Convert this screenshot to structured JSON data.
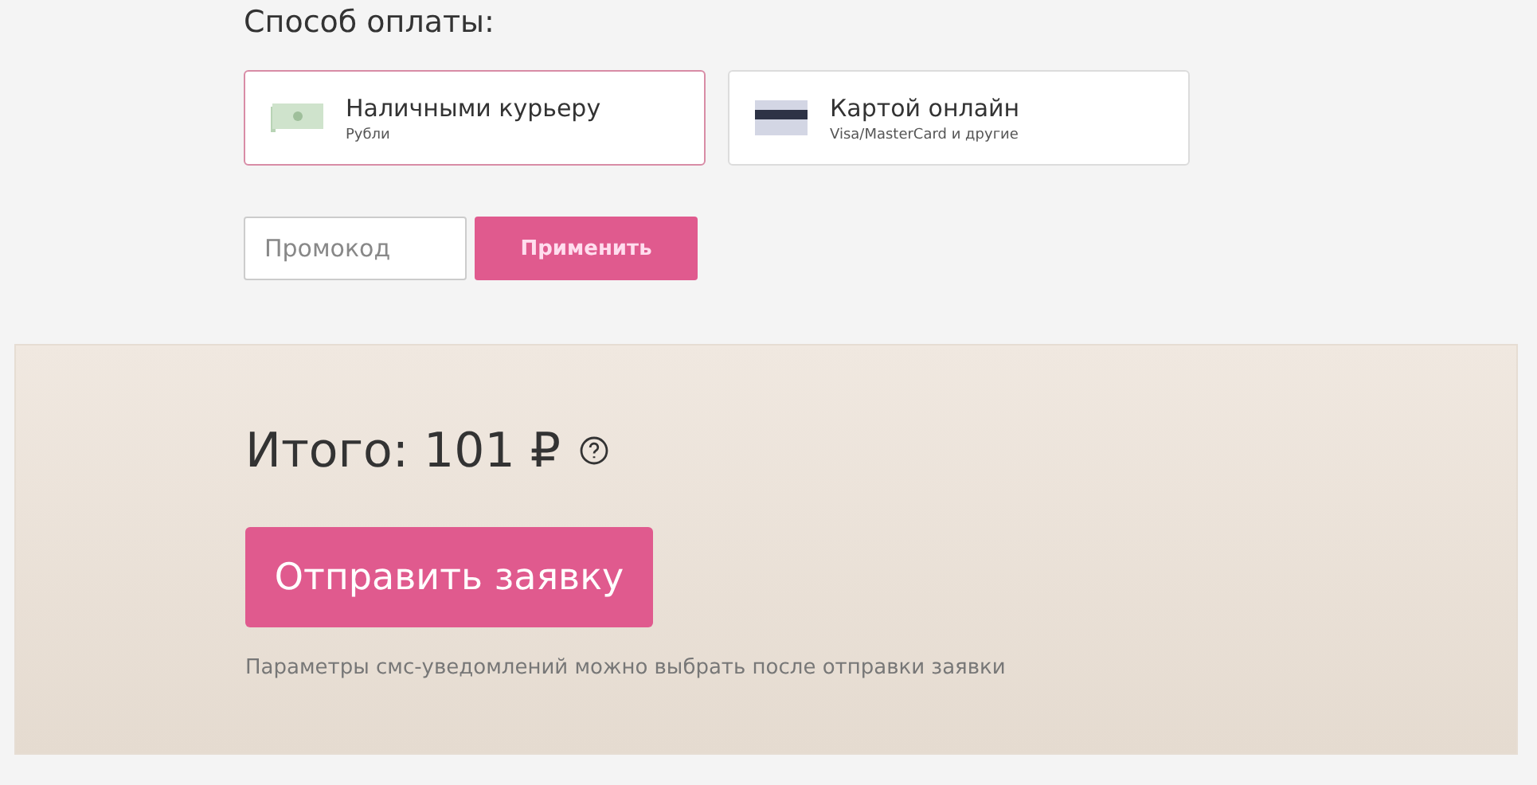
{
  "payment": {
    "title": "Способ оплаты:",
    "options": [
      {
        "kind": "cash",
        "label": "Наличными курьеру",
        "sublabel": "Рубли",
        "selected": true
      },
      {
        "kind": "card",
        "label": "Картой онлайн",
        "sublabel": "Visa/MasterCard и другие",
        "selected": false
      }
    ]
  },
  "promo": {
    "placeholder": "Промокод",
    "button": "Применить"
  },
  "summary": {
    "total": "Итого: 101 ₽",
    "submit": "Отправить заявку",
    "note": "Параметры смс-уведомлений можно выбрать после отправки заявки"
  }
}
